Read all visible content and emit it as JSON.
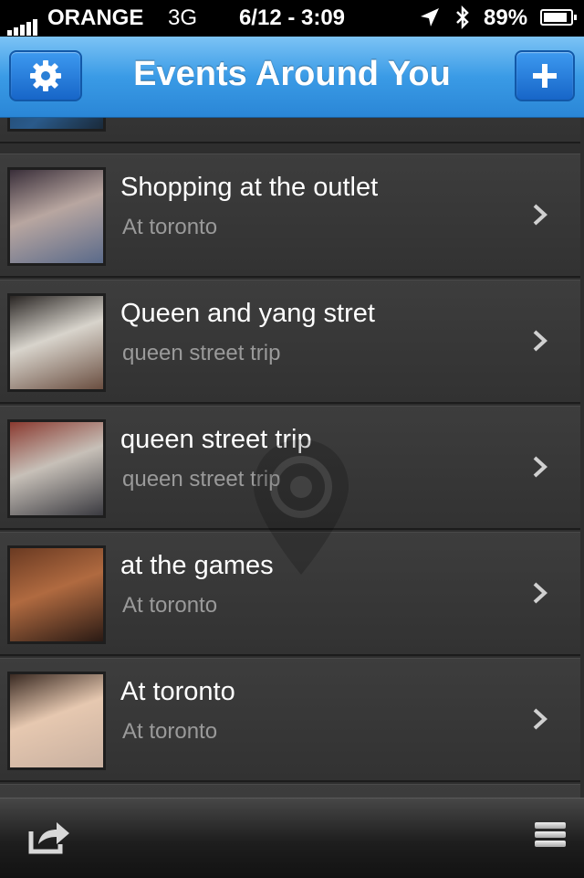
{
  "status_bar": {
    "carrier": "ORANGE",
    "network": "3G",
    "time": "6/12 - 3:09",
    "battery": "89%",
    "battery_level": 0.89,
    "icons": [
      "signal-bars-icon",
      "location-arrow-icon",
      "bluetooth-icon",
      "battery-icon"
    ]
  },
  "nav": {
    "title": "Events Around You",
    "left_icon": "gear-icon",
    "right_icon": "plus-icon"
  },
  "events": [
    {
      "title": "Shopping at the outlet",
      "subtitle": "At toronto",
      "thumb_colors": [
        "#3a2f3a",
        "#b8a6a0",
        "#5a6a8a"
      ]
    },
    {
      "title": "Queen and yang stret",
      "subtitle": "queen street trip",
      "thumb_colors": [
        "#2a2624",
        "#d8d4cc",
        "#6a4e40"
      ]
    },
    {
      "title": "queen street trip",
      "subtitle": "queen street trip",
      "thumb_colors": [
        "#8a3a30",
        "#c7c0b8",
        "#3a3a40"
      ]
    },
    {
      "title": "at the games",
      "subtitle": "At toronto",
      "thumb_colors": [
        "#6a3a22",
        "#b06a40",
        "#2a1a14"
      ]
    },
    {
      "title": "At toronto",
      "subtitle": "At toronto",
      "thumb_colors": [
        "#3a2a22",
        "#e6c8b0",
        "#c8b0a0"
      ]
    }
  ],
  "toolbar": {
    "left_icon": "share-icon",
    "right_icon": "menu-icon"
  }
}
